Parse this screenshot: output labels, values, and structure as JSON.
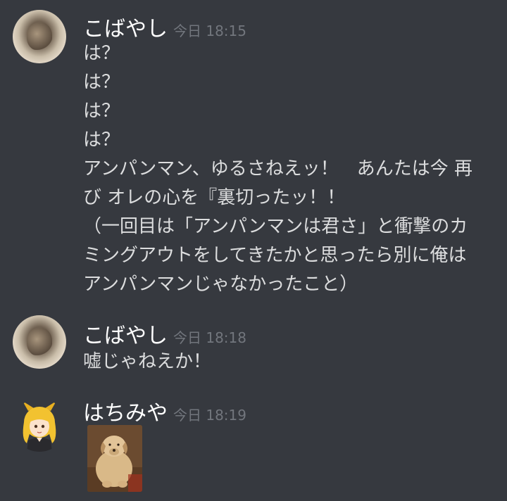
{
  "messages": [
    {
      "author": "こばやし",
      "timestamp": "今日 18:15",
      "lines": [
        "は？",
        "は？",
        "は？",
        "は？",
        "アンパンマン、ゆるさねえッ！　あんたは今 再",
        "び オレの心を『裏切ったッ！！",
        "（一回目は「アンパンマンは君さ」と衝撃のカ",
        "ミングアウトをしてきたかと思ったら別に俺は",
        "アンパンマンじゃなかったこと）"
      ]
    },
    {
      "author": "こばやし",
      "timestamp": "今日 18:18",
      "lines": [
        "嘘じゃねえか！"
      ]
    },
    {
      "author": "はちみや",
      "timestamp": "今日 18:19",
      "lines": [],
      "attachment": "dog-image"
    }
  ],
  "colors": {
    "background": "#36393f",
    "username": "#ffffff",
    "timestamp": "#72767d",
    "text": "#dcddde"
  }
}
